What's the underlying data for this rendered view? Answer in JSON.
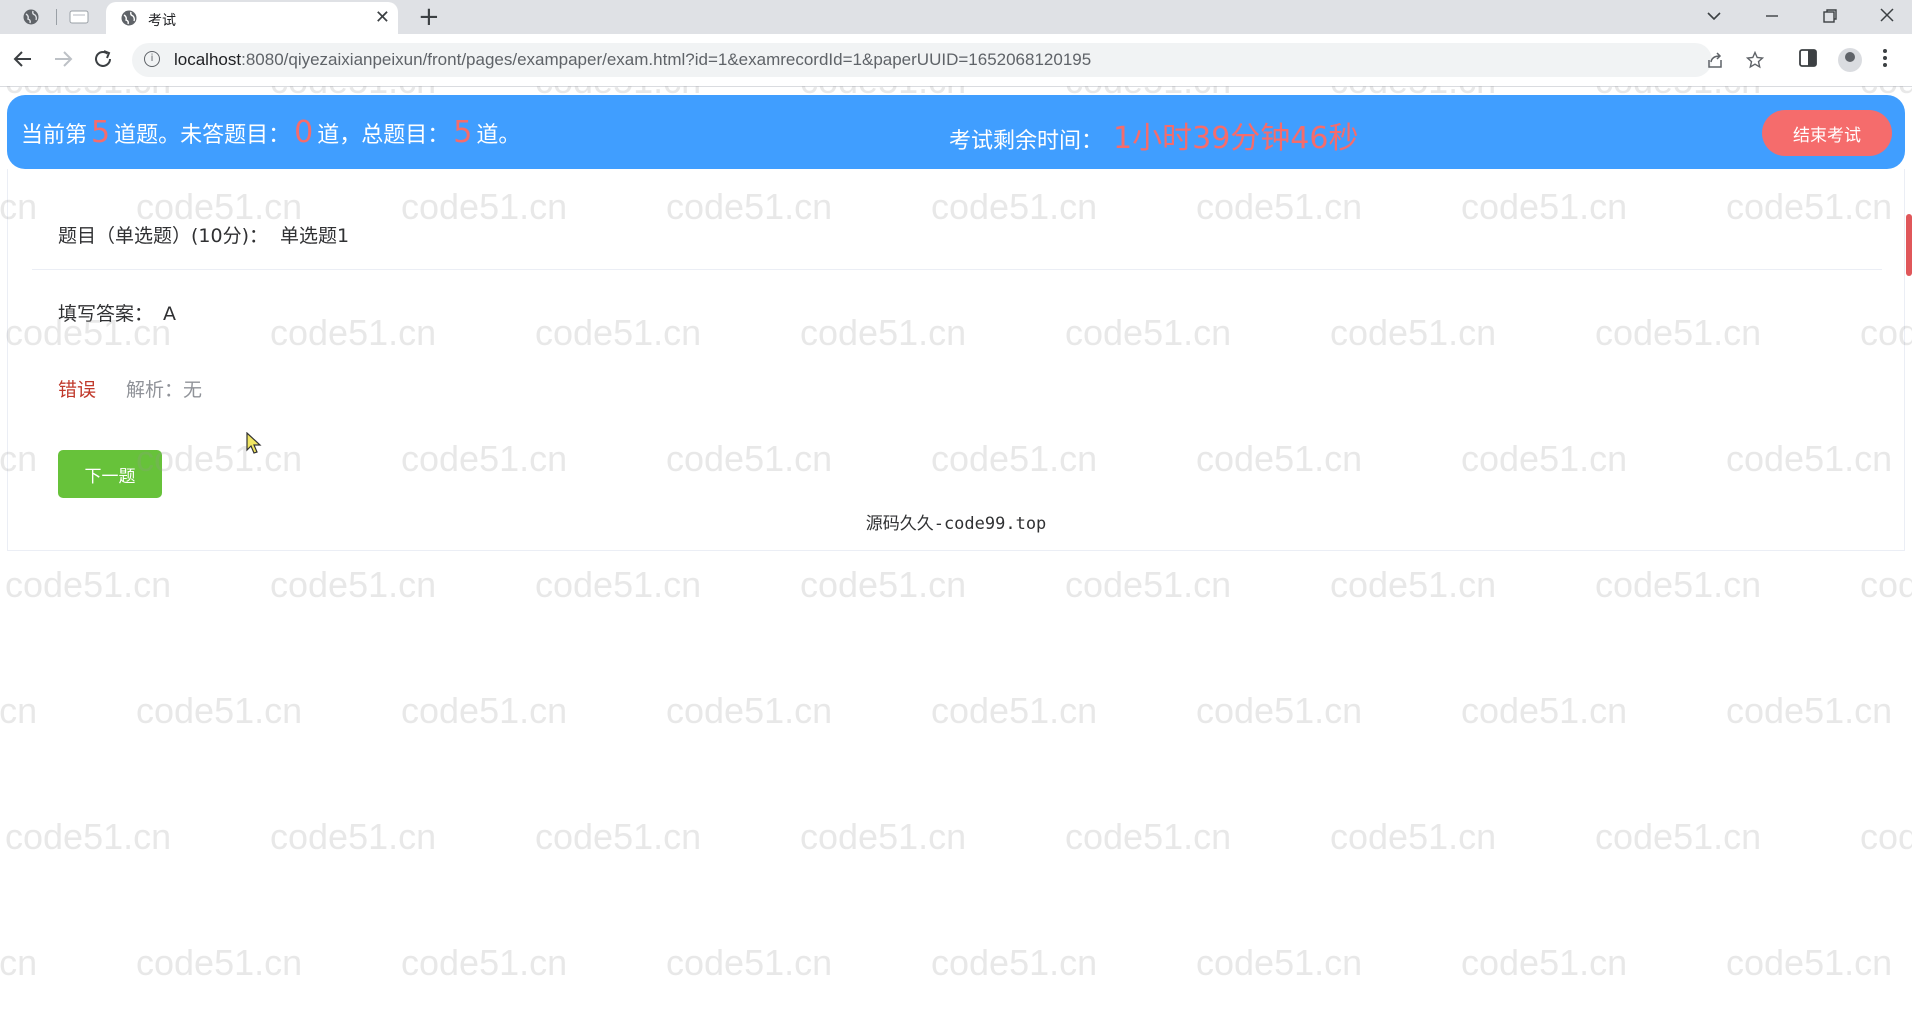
{
  "browser": {
    "tab_title": "考试",
    "url_host": "localhost",
    "url_rest": ":8080/qiyezaixianpeixun/front/pages/exampaper/exam.html?id=1&examrecordId=1&paperUUID=1652068120195",
    "new_tab_symbol": "+",
    "close_symbol": "✕"
  },
  "header": {
    "current_prefix": "当前第",
    "current_num": "5",
    "current_suffix": "道题。未答题目：",
    "unanswered_num": "0",
    "unanswered_suffix": "道，总题目：",
    "total_num": "5",
    "total_suffix": "道。",
    "time_label": "考试剩余时间：",
    "time_value": "1小时39分钟46秒",
    "end_button": "结束考试"
  },
  "question": {
    "title_label": "题目（单选题）(10分)：",
    "title_text": "单选题1",
    "answer_label": "填写答案：",
    "answer_value": "A",
    "result": "错误",
    "analysis": "解析：无",
    "next_button": "下一题"
  },
  "footer": {
    "note": "源码久久-code99.top"
  },
  "watermark": "code51.cn",
  "colors": {
    "header_bg": "#409eff",
    "highlight": "#f56c6c",
    "end_button": "#f56c6c",
    "next_button": "#67c23a",
    "wrong": "#c0392b"
  }
}
